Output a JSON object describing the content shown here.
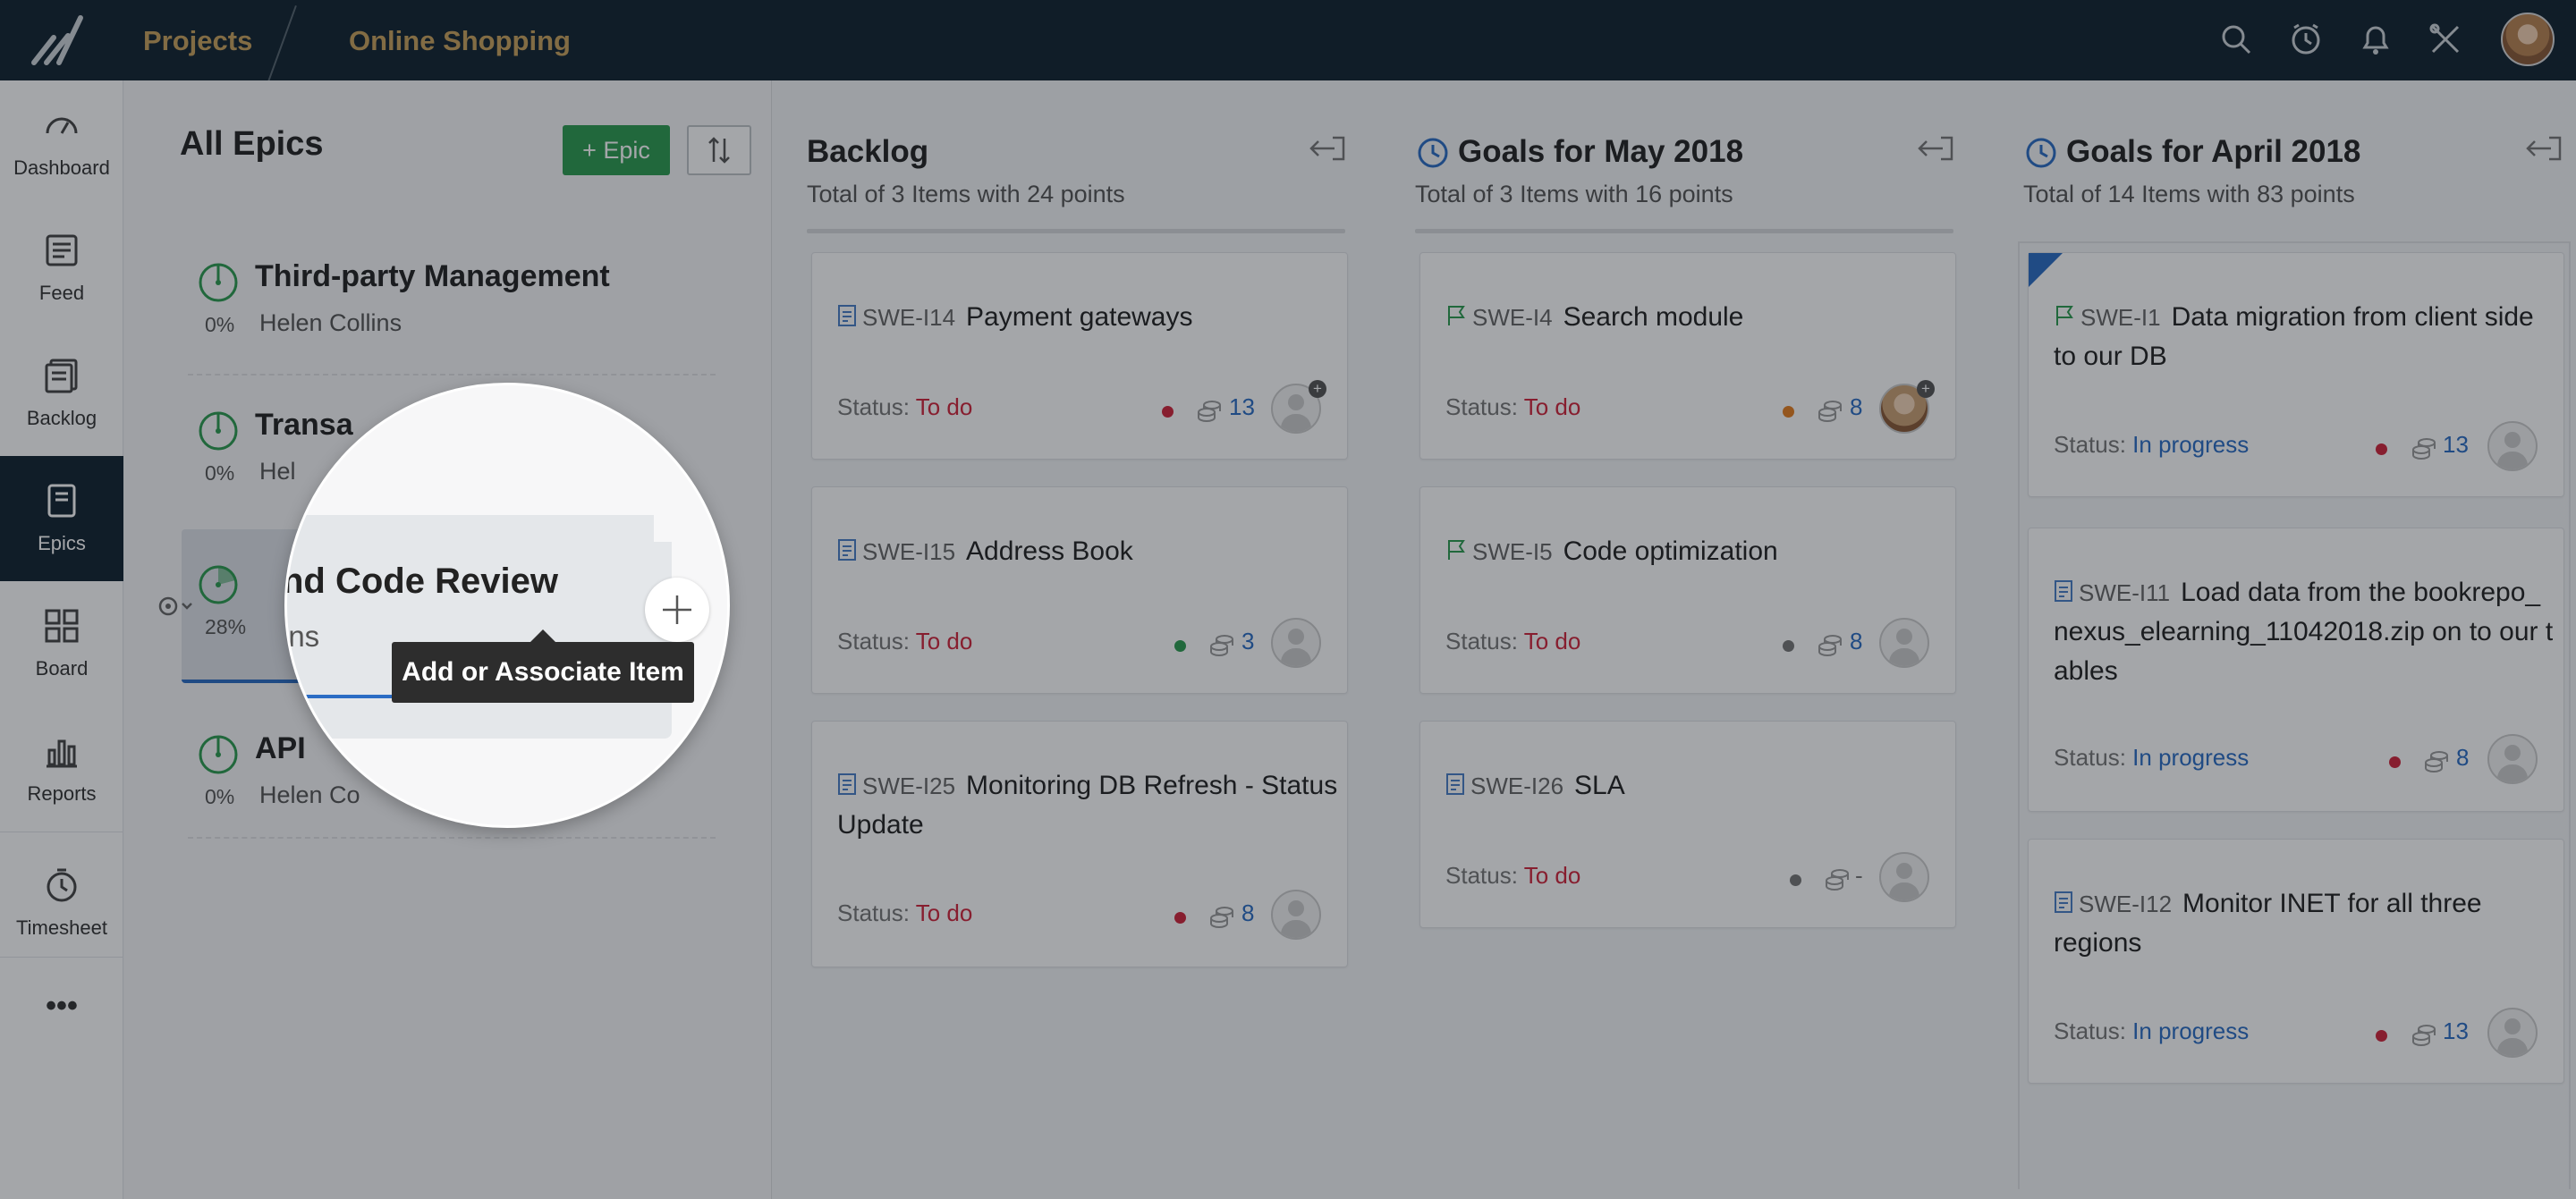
{
  "topbar": {
    "crumb_projects": "Projects",
    "crumb_project": "Online Shopping",
    "icons": [
      "search-icon",
      "timer-icon",
      "bell-icon",
      "tools-icon"
    ]
  },
  "sidebar": {
    "items": [
      {
        "label": "Dashboard",
        "icon": "dashboard-icon"
      },
      {
        "label": "Feed",
        "icon": "feed-icon"
      },
      {
        "label": "Backlog",
        "icon": "backlog-icon"
      },
      {
        "label": "Epics",
        "icon": "epics-icon",
        "active": true
      },
      {
        "label": "Board",
        "icon": "board-icon"
      },
      {
        "label": "Reports",
        "icon": "reports-icon"
      },
      {
        "label": "Timesheet",
        "icon": "timesheet-icon"
      }
    ],
    "more": "•••"
  },
  "epics": {
    "title": "All Epics",
    "add_label": "+ Epic",
    "items": [
      {
        "name": "Third-party Management",
        "pct": "0%",
        "owner": "Helen Collins"
      },
      {
        "name": "Transa",
        "pct": "0%",
        "owner": "Hel"
      },
      {
        "name": "",
        "pct": "28%",
        "owner": ""
      },
      {
        "name": "API",
        "pct": "0%",
        "owner": "Helen Co"
      }
    ]
  },
  "magnifier": {
    "title": "nd Code Review",
    "subtitle": "ins",
    "tooltip": "Add or Associate Item"
  },
  "columns": [
    {
      "title": "Backlog",
      "subtitle": "Total of 3 Items with 24 points",
      "cards": [
        {
          "code": "SWE-I14",
          "name": "Payment gateways",
          "status_label": "Status:",
          "status": "To do",
          "points": "13",
          "dot": "#d0253b"
        },
        {
          "code": "SWE-I15",
          "name": "Address Book",
          "status_label": "Status:",
          "status": "To do",
          "points": "3",
          "dot": "#2c9b4f"
        },
        {
          "code": "SWE-I25",
          "name": "Monitoring DB Refresh - Status Update",
          "status_label": "Status:",
          "status": "To do",
          "points": "8",
          "dot": "#d0253b"
        }
      ]
    },
    {
      "title": "Goals for May 2018",
      "subtitle": "Total of 3 Items with 16 points",
      "cards": [
        {
          "code": "SWE-I4",
          "name": "Search module",
          "status_label": "Status:",
          "status": "To do",
          "points": "8",
          "dot": "#e57f1f"
        },
        {
          "code": "SWE-I5",
          "name": "Code optimization",
          "status_label": "Status:",
          "status": "To do",
          "points": "8",
          "dot": "#777777"
        },
        {
          "code": "SWE-I26",
          "name": "SLA",
          "status_label": "Status:",
          "status": "To do",
          "points": "-",
          "dot": "#777777"
        }
      ]
    },
    {
      "title": "Goals for April 2018",
      "subtitle": "Total of 14 Items with 83 points",
      "cards": [
        {
          "code": "SWE-I1",
          "name": "Data migration from client side to our DB",
          "status_label": "Status:",
          "status": "In progress",
          "points": "13",
          "dot": "#d0253b"
        },
        {
          "code": "SWE-I11",
          "name": "Load data from the bookrepo_nexus_elearning_11042018.zip on to our tables",
          "status_label": "Status:",
          "status": "In progress",
          "points": "8",
          "dot": "#d0253b"
        },
        {
          "code": "SWE-I12",
          "name": "Monitor INET for all three regions",
          "status_label": "Status:",
          "status": "In progress",
          "points": "13",
          "dot": "#d0253b"
        }
      ]
    }
  ]
}
